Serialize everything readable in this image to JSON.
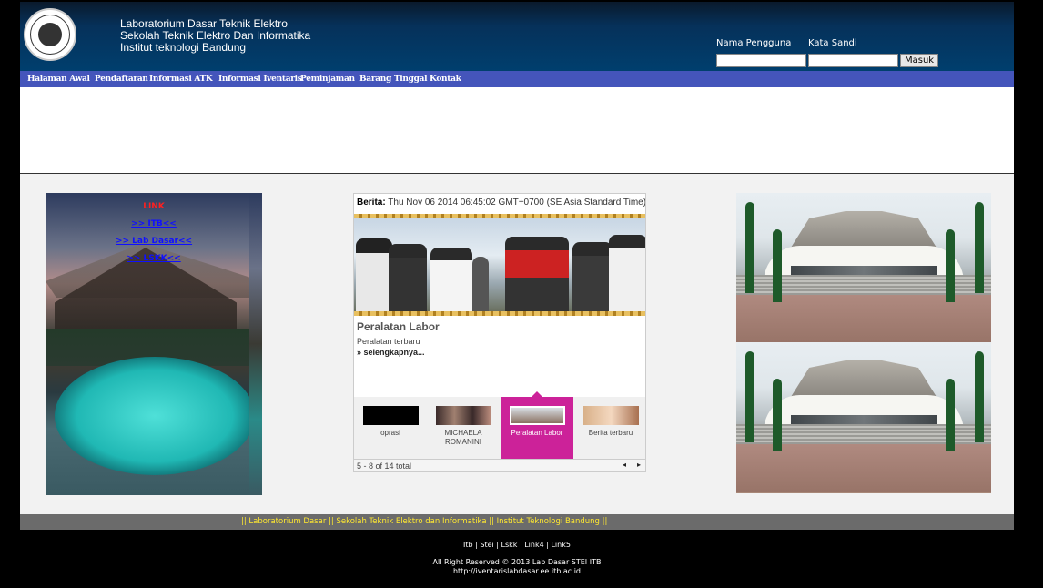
{
  "header": {
    "title_lines": [
      "Laboratorium Dasar Teknik Elektro",
      "Sekolah Teknik Elektro Dan Informatika",
      "Institut teknologi Bandung"
    ],
    "username_label": "Nama Pengguna",
    "password_label": "Kata Sandi",
    "username_value": "",
    "password_value": "",
    "login_button": "Masuk"
  },
  "nav": {
    "items": [
      "Halaman Awal",
      "Pendaftaran",
      "Informasi ATK",
      "Informasi Iventaris",
      "Peminjaman",
      "Barang Tinggal",
      "Kontak"
    ]
  },
  "links_panel": {
    "title": "LINK",
    "items": [
      ">> ITB<<",
      ">> Lab Dasar<<",
      ">> LSKK<<"
    ]
  },
  "news": {
    "label": "Berita:",
    "datetime": "Thu Nov 06 2014 06:45:02 GMT+0700 (SE Asia Standard Time)",
    "title": "Peralatan Labor",
    "subtitle": "Peralatan terbaru",
    "more": "» selengkapnya...",
    "thumbnails": [
      {
        "label": "oprasi",
        "active": false
      },
      {
        "label": "MICHAELA ROMANINI",
        "active": false
      },
      {
        "label": "Peralatan Labor",
        "active": true
      },
      {
        "label": "Berita terbaru",
        "active": false
      }
    ],
    "pager": "5 - 8 of 14 total"
  },
  "footer": {
    "links_bar": "|| Laboratorium Dasar || Sekolah Teknik Elektro dan Informatika || Institut Teknologi Bandung ||",
    "links": "Itb | Stei | Lskk | Link4 | Link5",
    "copyright": "All Right Reserved © 2013 Lab Dasar STEI ITB",
    "url": "http://iventarislabdasar.ee.itb.ac.id"
  },
  "colors": {
    "nav_bg": "#4455bb",
    "header_bg": "#003f6e",
    "active_thumb": "#cc2299",
    "footer_link": "#ffe830"
  }
}
